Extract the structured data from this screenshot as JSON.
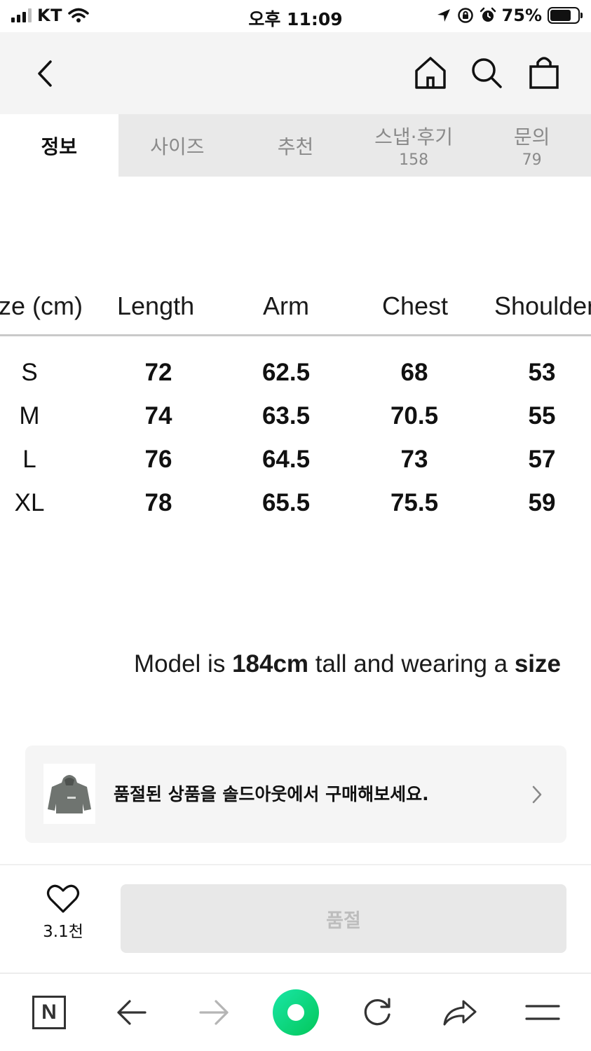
{
  "status_bar": {
    "carrier": "KT",
    "time": "오후 11:09",
    "battery_text": "75%",
    "battery_level": 0.75
  },
  "nav": {
    "icons": [
      "back-arrow-icon",
      "home-icon",
      "search-icon",
      "shopping-bag-icon"
    ]
  },
  "tabs": [
    {
      "label": "정보",
      "count": ""
    },
    {
      "label": "사이즈",
      "count": ""
    },
    {
      "label": "추천",
      "count": ""
    },
    {
      "label": "스냅·후기",
      "count": "158"
    },
    {
      "label": "문의",
      "count": "79"
    }
  ],
  "size_table": {
    "headers": [
      "ze (cm)",
      "Length",
      "Arm",
      "Chest",
      "Shoulder"
    ],
    "rows": [
      [
        "S",
        "72",
        "62.5",
        "68",
        "53"
      ],
      [
        "M",
        "74",
        "63.5",
        "70.5",
        "55"
      ],
      [
        "L",
        "76",
        "64.5",
        "73",
        "57"
      ],
      [
        "XL",
        "78",
        "65.5",
        "75.5",
        "59"
      ]
    ]
  },
  "model_note": {
    "prefix": "Model is ",
    "height": "184cm",
    "middle": " tall and wearing a ",
    "tail": "size"
  },
  "soldout_banner": {
    "text": "품절된 상품을 솔드아웃에서 구매해보세요."
  },
  "buy_bar": {
    "like_count": "3.1천",
    "button_label": "품절"
  },
  "browser_bar": {
    "naver_label": "N",
    "icons": [
      "naver-n-icon",
      "back-icon",
      "forward-icon",
      "green-dot-icon",
      "reload-icon",
      "share-icon",
      "menu-icon"
    ]
  }
}
